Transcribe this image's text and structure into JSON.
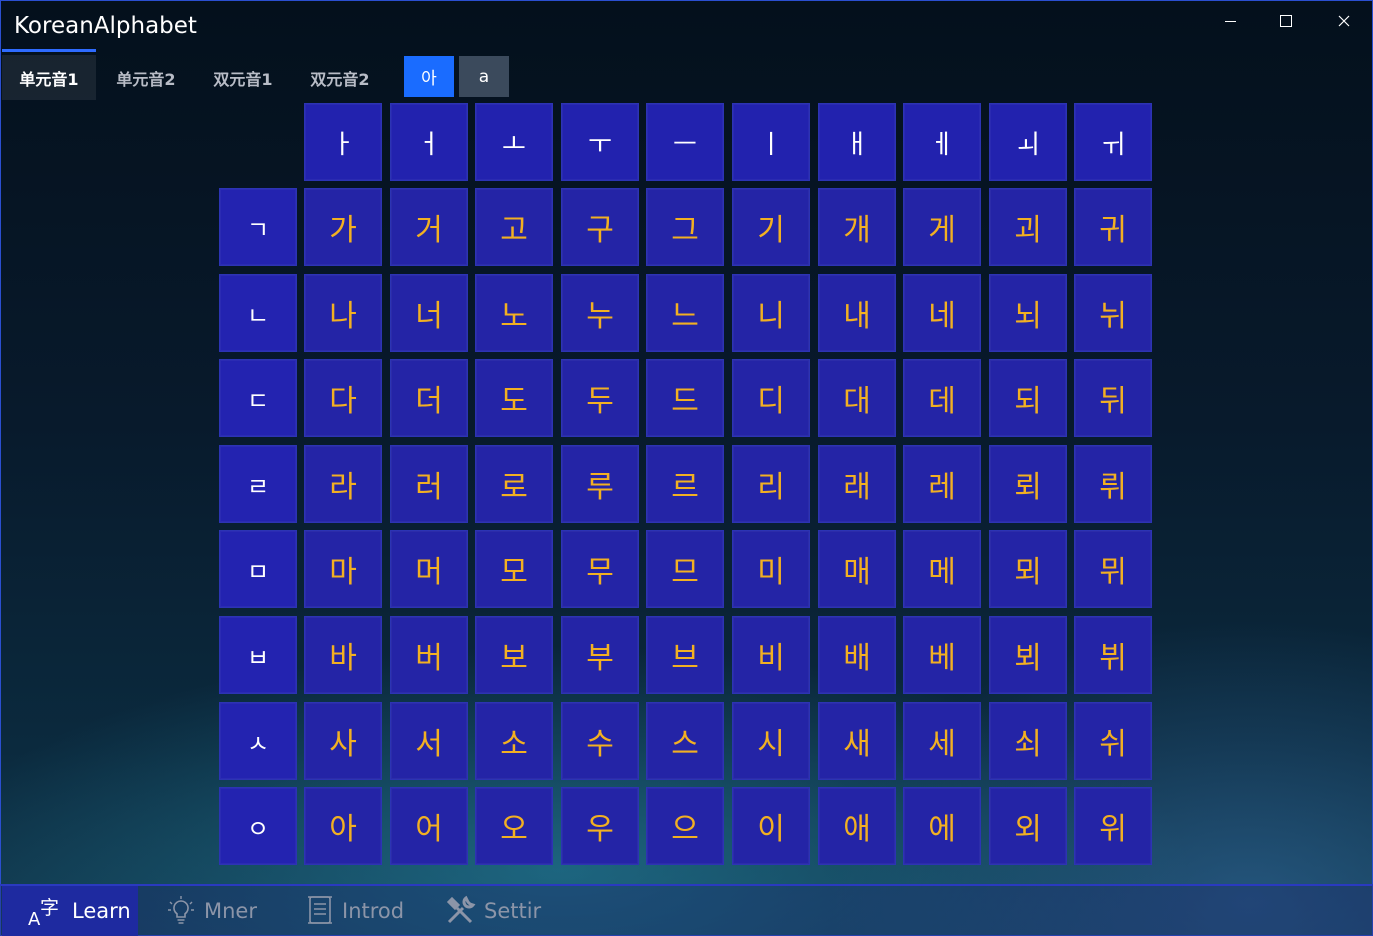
{
  "app": {
    "title": "KoreanAlphabet"
  },
  "window_controls": {
    "minimize": "minimize-icon",
    "maximize": "maximize-icon",
    "close": "close-icon"
  },
  "tabs": [
    {
      "label": "单元音1",
      "active": true
    },
    {
      "label": "单元音2",
      "active": false
    },
    {
      "label": "双元音1",
      "active": false
    },
    {
      "label": "双元音2",
      "active": false
    }
  ],
  "script_toggle": {
    "korean": "아",
    "latin": "a",
    "selected": "korean"
  },
  "vowels": [
    "ㅏ",
    "ㅓ",
    "ㅗ",
    "ㅜ",
    "ㅡ",
    "ㅣ",
    "ㅐ",
    "ㅔ",
    "ㅚ",
    "ㅟ"
  ],
  "consonants": [
    "ㄱ",
    "ㄴ",
    "ㄷ",
    "ㄹ",
    "ㅁ",
    "ㅂ",
    "ㅅ",
    "ㅇ"
  ],
  "syllables": [
    [
      "가",
      "거",
      "고",
      "구",
      "그",
      "기",
      "개",
      "게",
      "괴",
      "귀"
    ],
    [
      "나",
      "너",
      "노",
      "누",
      "느",
      "니",
      "내",
      "네",
      "뇌",
      "뉘"
    ],
    [
      "다",
      "더",
      "도",
      "두",
      "드",
      "디",
      "대",
      "데",
      "되",
      "뒤"
    ],
    [
      "라",
      "러",
      "로",
      "루",
      "르",
      "리",
      "래",
      "레",
      "뢰",
      "뤼"
    ],
    [
      "마",
      "머",
      "모",
      "무",
      "므",
      "미",
      "매",
      "메",
      "뫼",
      "뮈"
    ],
    [
      "바",
      "버",
      "보",
      "부",
      "브",
      "비",
      "배",
      "베",
      "뵈",
      "뷔"
    ],
    [
      "사",
      "서",
      "소",
      "수",
      "스",
      "시",
      "새",
      "세",
      "쇠",
      "쉬"
    ],
    [
      "아",
      "어",
      "오",
      "우",
      "으",
      "이",
      "애",
      "에",
      "외",
      "위"
    ]
  ],
  "colors": {
    "accent": "#1a6cff",
    "cell": "#2424a6",
    "syllable_text": "#f2b022"
  },
  "bottom_nav": [
    {
      "label": "Learn",
      "icon": "learn-icon",
      "active": true
    },
    {
      "label": "Mner",
      "icon": "lightbulb-icon",
      "active": false
    },
    {
      "label": "Introd",
      "icon": "scroll-icon",
      "active": false
    },
    {
      "label": "Settir",
      "icon": "tools-icon",
      "active": false
    }
  ]
}
